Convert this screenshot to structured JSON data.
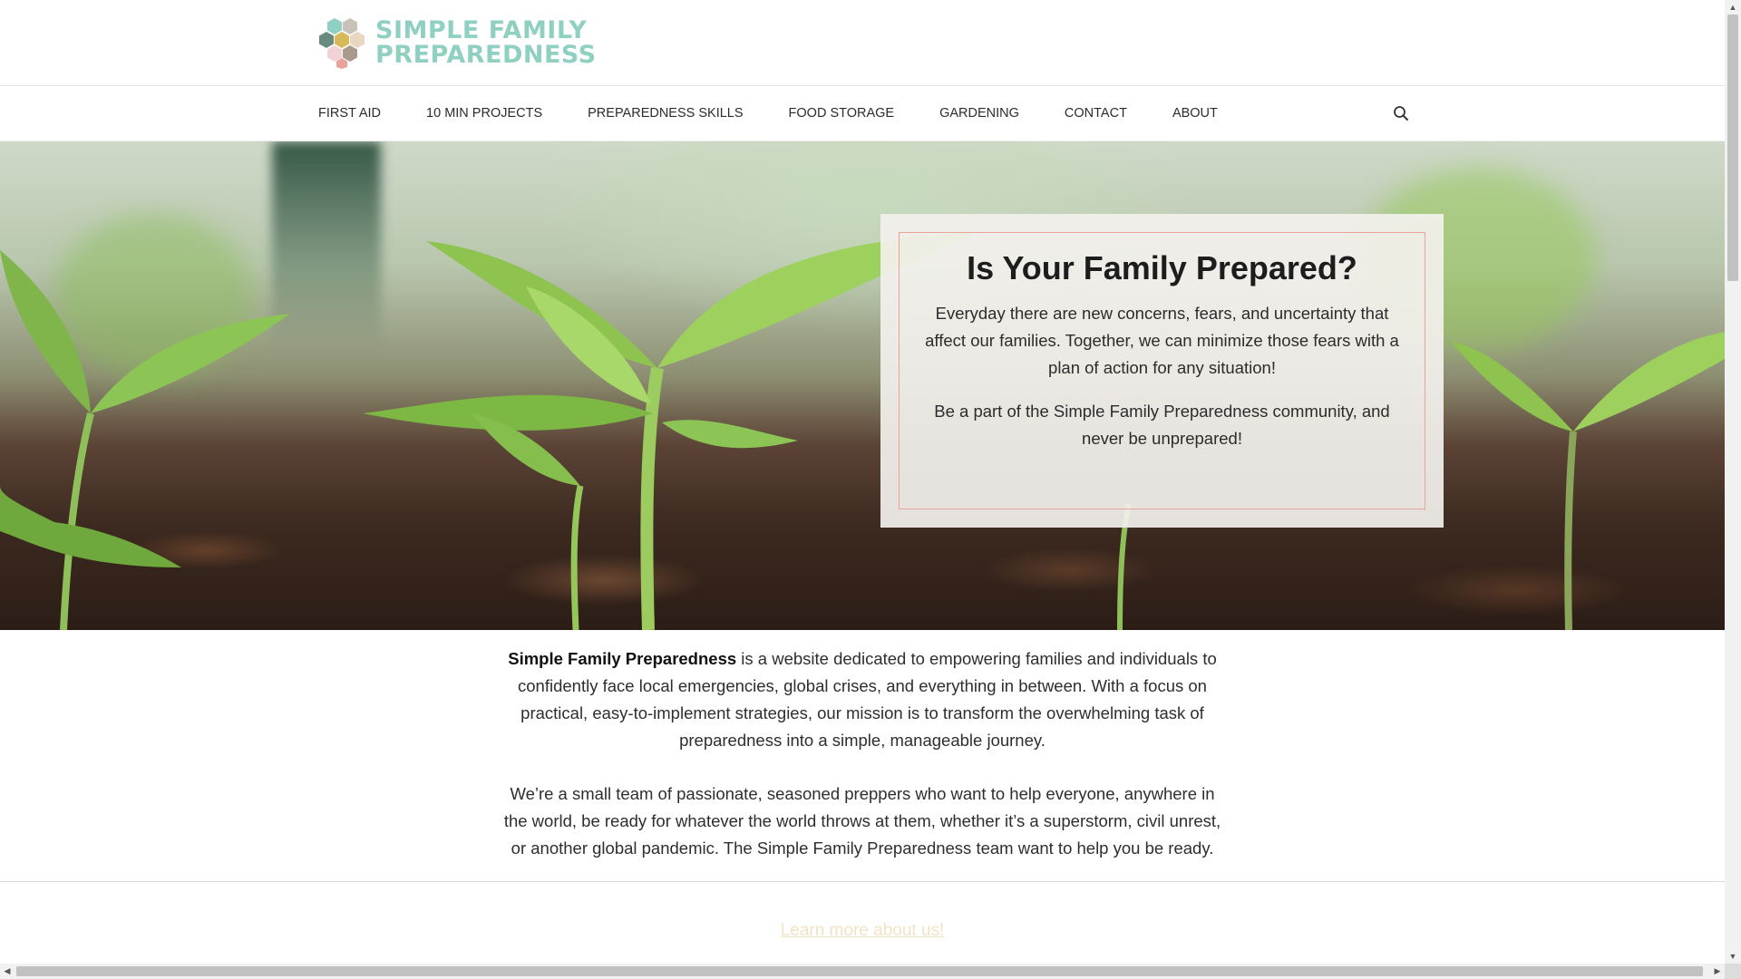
{
  "header": {
    "logo_line1": "SIMPLE FAMILY",
    "logo_line2": "PREPAREDNESS",
    "logo_colors": [
      "#8fd0c2",
      "#6a8a80",
      "#d9b85a",
      "#f1d2d6",
      "#a99a8b",
      "#e8a39b"
    ]
  },
  "nav": {
    "items": [
      {
        "label": "FIRST AID"
      },
      {
        "label": "10 MIN PROJECTS"
      },
      {
        "label": "PREPAREDNESS SKILLS"
      },
      {
        "label": "FOOD STORAGE"
      },
      {
        "label": "GARDENING"
      },
      {
        "label": "CONTACT"
      },
      {
        "label": "ABOUT"
      }
    ],
    "search_icon": "search-icon"
  },
  "hero": {
    "title": "Is Your Family Prepared?",
    "paragraph1": "Everyday there are new concerns, fears, and uncertainty that affect our families. Together, we can minimize those fears with a plan of action for any situation!",
    "paragraph2": "Be a part of the Simple Family Preparedness community, and never be unprepared!",
    "border_color": "#e8a39b"
  },
  "intro": {
    "site_name": "Simple Family Preparedness",
    "paragraph1_rest": " is a website dedicated to empowering families and individuals to confidently face local emergencies, global crises, and everything in between. With a focus on practical, easy-to-implement strategies, our mission is to transform the overwhelming task of preparedness into a simple, manageable journey.",
    "paragraph2": "We’re a small team of passionate, seasoned preppers who want to help everyone, anywhere in the world, be ready for whatever the world throws at them, whether it’s a superstorm, civil unrest, or another global pandemic. The Simple Family Preparedness team want to help you be ready.",
    "learn_more": "Learn more about us!"
  }
}
